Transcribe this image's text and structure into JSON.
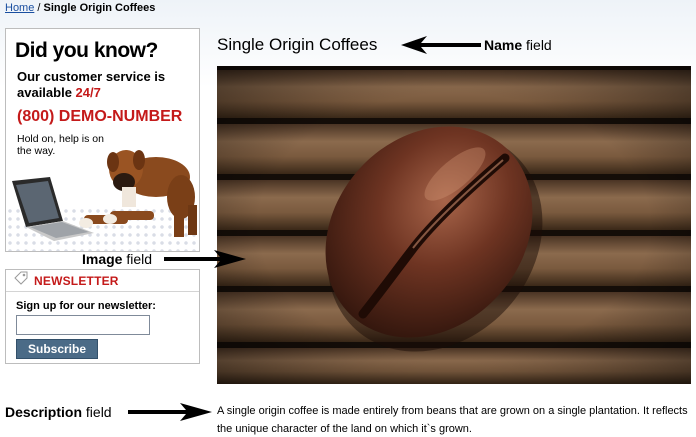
{
  "breadcrumb": {
    "home": "Home",
    "separator": "/",
    "current": "Single Origin Coffees"
  },
  "ad": {
    "headline": "Did you know?",
    "line_part1": "Our customer service is available ",
    "line_highlight": "24/7",
    "phone": "(800) DEMO-NUMBER",
    "hold_text": "Hold on, help is on the way.",
    "accent_color": "#c41a1a"
  },
  "newsletter": {
    "title": "NEWSLETTER",
    "label": "Sign up for our newsletter:",
    "input_value": "",
    "button_label": "Subscribe",
    "icon": "tag-icon"
  },
  "product": {
    "title": "Single Origin Coffees",
    "description": "A single origin coffee is made entirely from beans that are grown on a single plantation. It reflects the unique character of the land on which it`s grown."
  },
  "annotations": {
    "name": {
      "bold": "Name",
      "rest": " field"
    },
    "image": {
      "bold": "Image",
      "rest": " field"
    },
    "description": {
      "bold": "Description",
      "rest": " field"
    }
  }
}
